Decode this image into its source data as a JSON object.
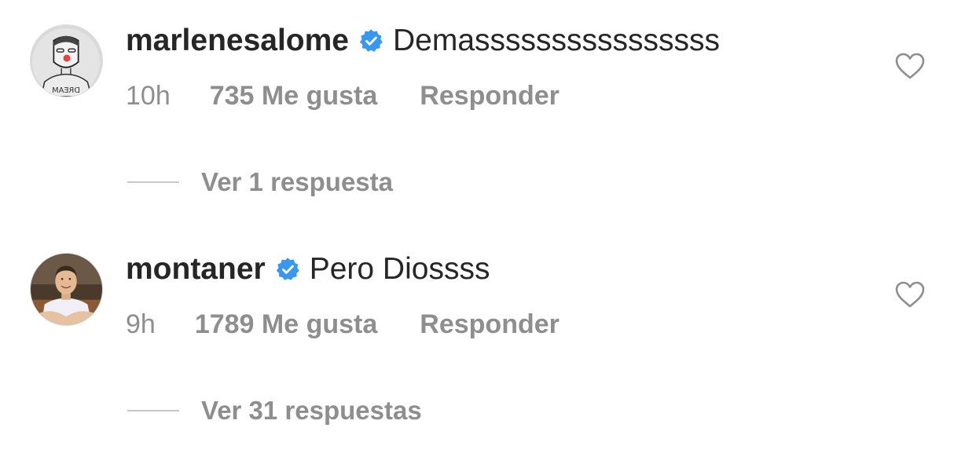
{
  "comments": [
    {
      "username": "marlenesalome",
      "text": "Demassssssssssssssss",
      "time": "10h",
      "likes": "735 Me gusta",
      "reply": "Responder",
      "view_replies": "Ver 1 respuesta",
      "avatar_icon": "sketch-figure-avatar",
      "verified": true
    },
    {
      "username": "montaner",
      "text": "Pero Diossss",
      "time": "9h",
      "likes": "1789 Me gusta",
      "reply": "Responder",
      "view_replies": "Ver 31 respuestas",
      "avatar_icon": "man-photo-avatar",
      "verified": true
    }
  ],
  "colors": {
    "primary_text": "#262626",
    "secondary_text": "#8e8e8e",
    "verified_blue": "#3897f0",
    "divider": "#c7c7c7"
  }
}
